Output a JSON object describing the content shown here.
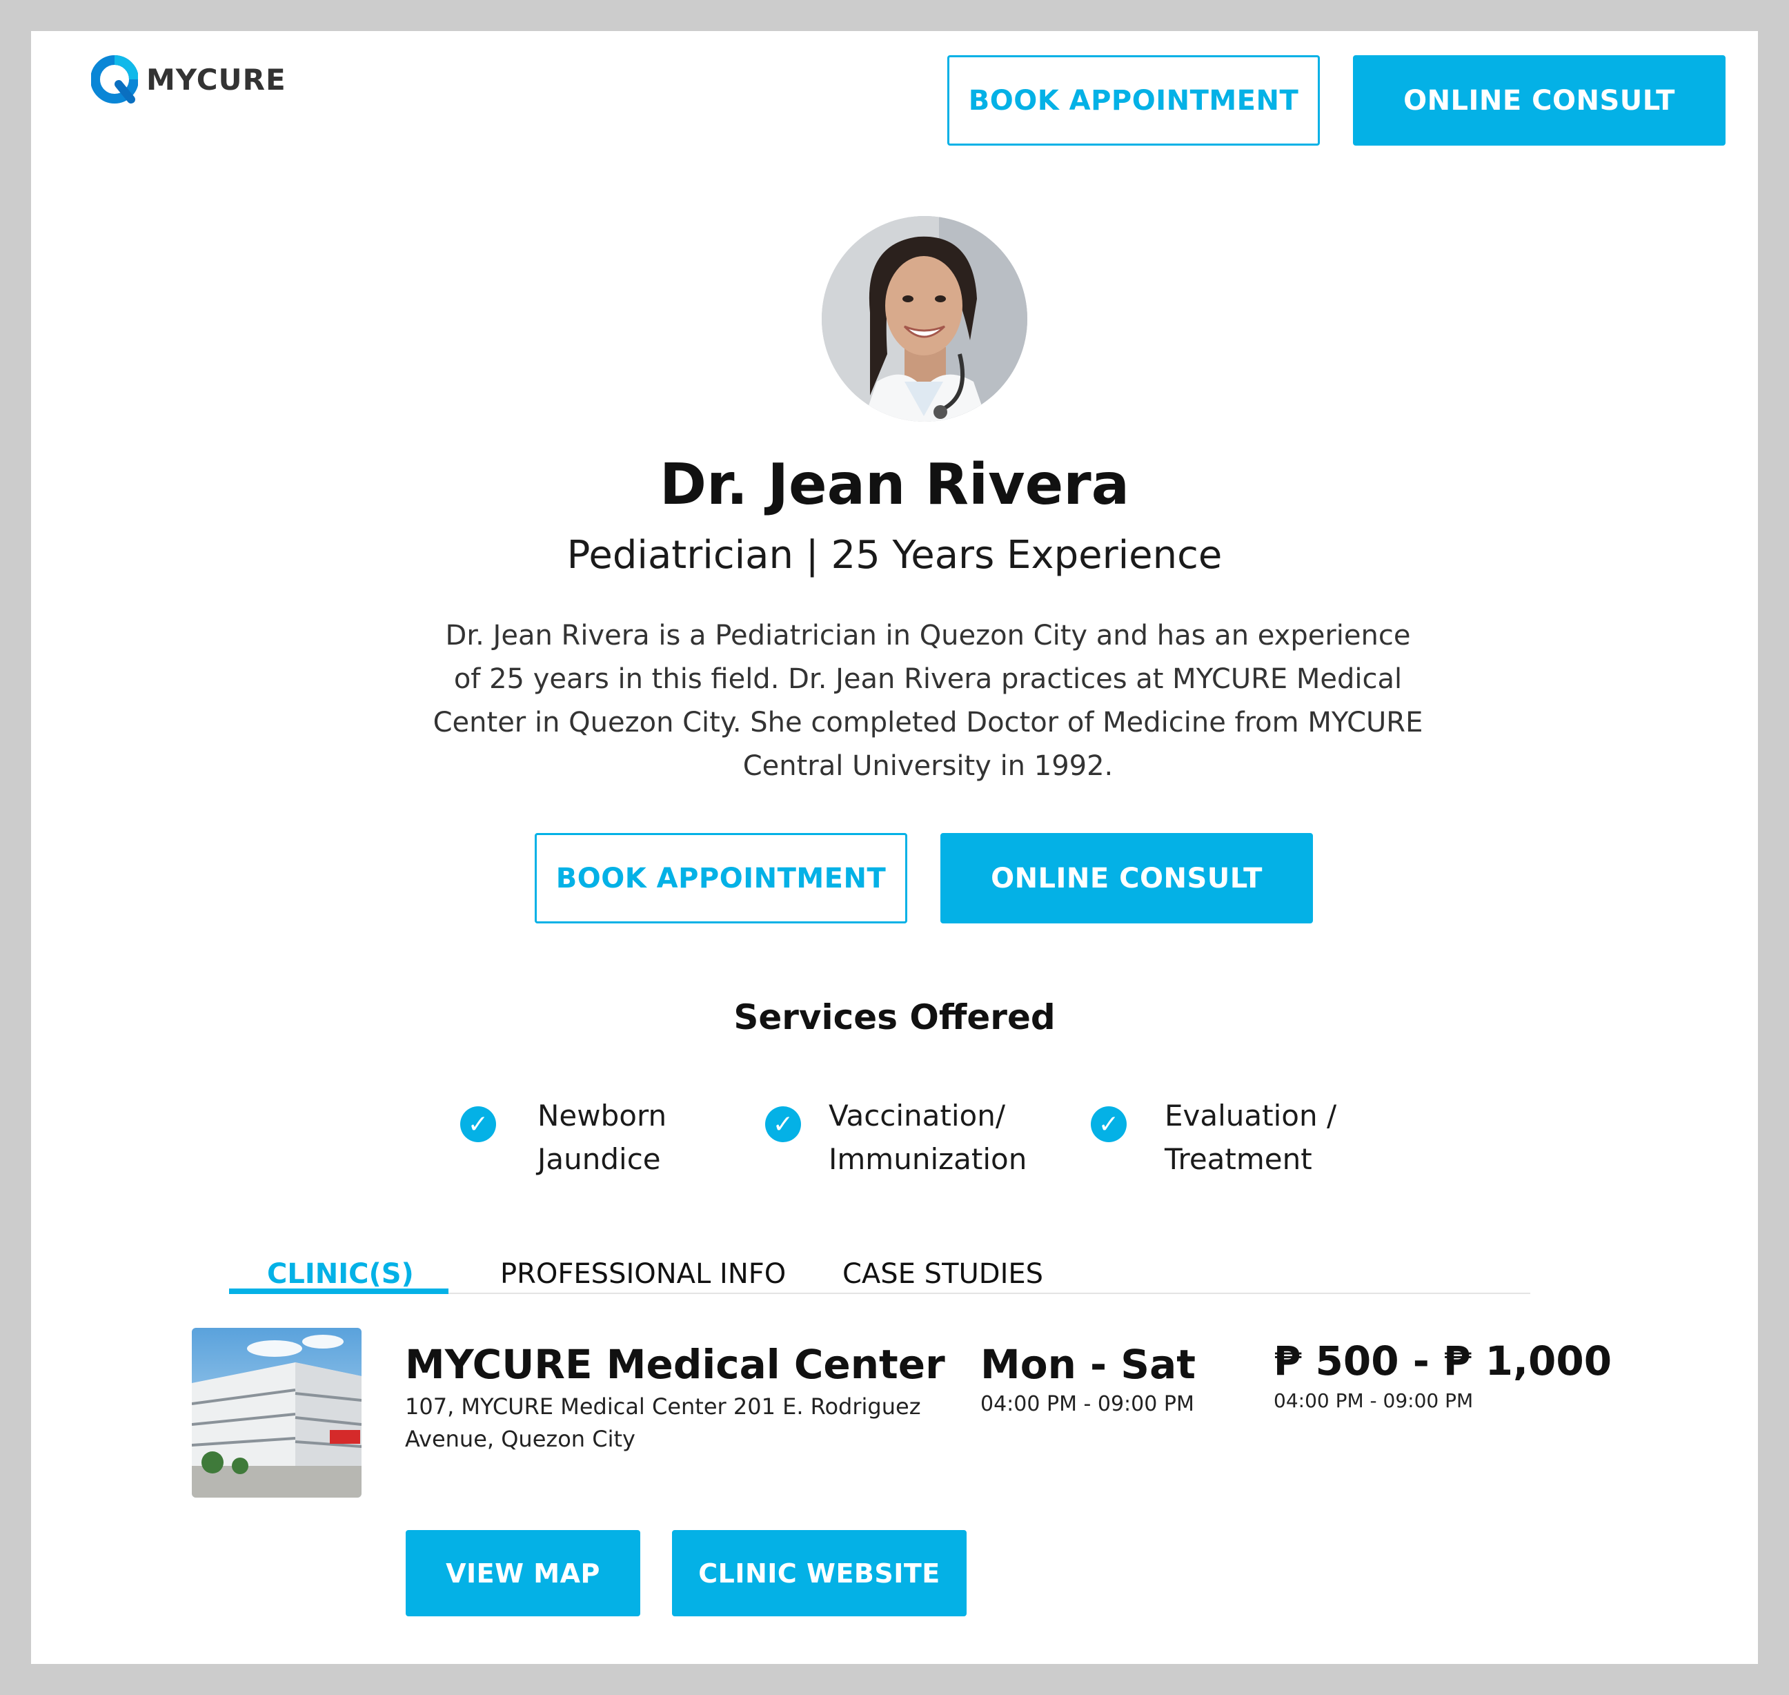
{
  "brand": {
    "name": "MYCURE",
    "accent": "#04b1e6"
  },
  "header": {
    "book_label": "BOOK APPOINTMENT",
    "consult_label": "ONLINE CONSULT"
  },
  "profile": {
    "name": "Dr. Jean Rivera",
    "specialty": "Pediatrician | 25 Years Experience",
    "bio": "Dr. Jean Rivera is a Pediatrician in Quezon City and has an experience of 25 years in this field. Dr. Jean Rivera practices at MYCURE Medical Center in Quezon City. She completed Doctor of Medicine from MYCURE Central University in 1992.",
    "book_label": "BOOK APPOINTMENT",
    "consult_label": "ONLINE CONSULT"
  },
  "services": {
    "title": "Services Offered",
    "items": [
      {
        "label": "Newborn\nJaundice",
        "icon": "check-circle-icon"
      },
      {
        "label": "Vaccination/\nImmunization",
        "icon": "check-circle-icon"
      },
      {
        "label": "Evaluation /\nTreatment",
        "icon": "check-circle-icon"
      }
    ]
  },
  "tabs": [
    {
      "label": "CLINIC(S)",
      "active": true
    },
    {
      "label": "PROFESSIONAL INFO",
      "active": false
    },
    {
      "label": "CASE STUDIES",
      "active": false
    }
  ],
  "clinic": {
    "name": "MYCURE Medical Center",
    "address": "107, MYCURE Medical Center 201 E. Rodriguez Avenue, Quezon City",
    "days": "Mon - Sat",
    "hours": "04:00 PM - 09:00 PM",
    "price": "₱ 500 - ₱ 1,000",
    "price_hours": "04:00 PM - 09:00 PM",
    "view_map_label": "VIEW MAP",
    "website_label": "CLINIC WEBSITE"
  }
}
